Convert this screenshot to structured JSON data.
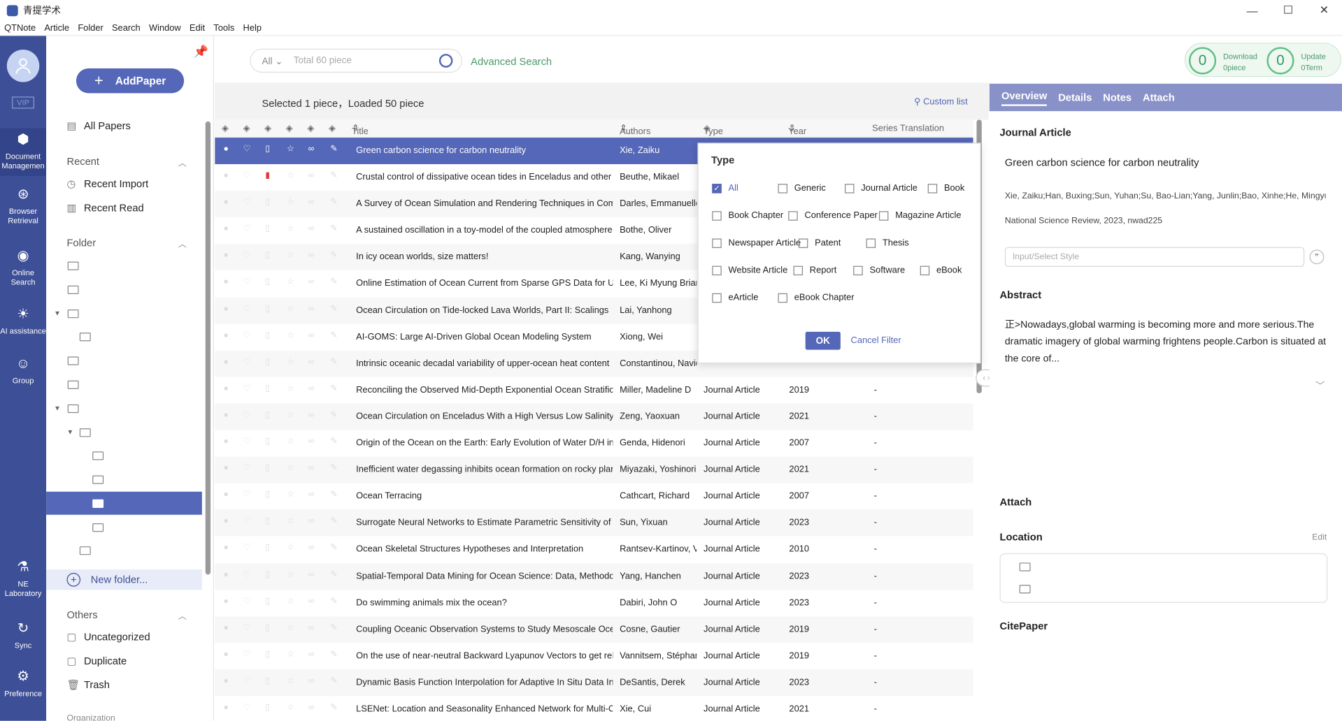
{
  "app": {
    "title": "青提学术"
  },
  "menu": [
    "QTNote",
    "Article",
    "Folder",
    "Search",
    "Window",
    "Edit",
    "Tools",
    "Help"
  ],
  "rail": {
    "vip": "VIP",
    "items": [
      {
        "label": "Document Managemen",
        "icon": "cube-icon"
      },
      {
        "label": "Browser Retrieval",
        "icon": "compass-icon"
      },
      {
        "label": "Online Search",
        "icon": "eye-icon"
      },
      {
        "label": "AI assistance",
        "icon": "bulb-icon"
      },
      {
        "label": "Group",
        "icon": "group-icon"
      },
      {
        "label": "NE Laboratory",
        "icon": "microscope-icon"
      },
      {
        "label": "Sync",
        "icon": "sync-icon"
      },
      {
        "label": "Preference",
        "icon": "gear-icon"
      }
    ]
  },
  "sidebar": {
    "add_paper": "AddPaper",
    "all_papers": "All Papers",
    "recent": "Recent",
    "recent_import": "Recent Import",
    "recent_read": "Recent Read",
    "folder": "Folder",
    "new_folder": "New folder...",
    "others": "Others",
    "uncategorized": "Uncategorized",
    "duplicate": "Duplicate",
    "trash": "Trash",
    "organization": "Organization"
  },
  "search": {
    "scope": "All",
    "placeholder": "Total 60 piece",
    "advanced": "Advanced Search"
  },
  "status": {
    "download_count": "0",
    "download_label": "Download",
    "download_sub": "0piece",
    "update_count": "0",
    "update_label": "Update",
    "update_sub": "0Term"
  },
  "list": {
    "info": "Selected 1 piece，Loaded 50 piece",
    "custom": "Custom list",
    "headers": {
      "title": "Title",
      "authors": "Authors",
      "type": "Type",
      "year": "Year",
      "series": "Series Translation"
    },
    "rows": [
      {
        "title": "Green carbon science for carbon neutrality",
        "author": "Xie, Zaiku",
        "type": "",
        "year": "",
        "series": ""
      },
      {
        "title": "Crustal control of dissipative ocean tides in Enceladus and other icy m",
        "author": "Beuthe, Mikael",
        "type": "",
        "year": "",
        "series": ""
      },
      {
        "title": "A Survey of Ocean Simulation and Rendering Techniques in Compute",
        "author": "Darles, Emmanuelle",
        "type": "",
        "year": "",
        "series": ""
      },
      {
        "title": "A sustained oscillation in a toy-model of the coupled atmosphere-oce",
        "author": "Bothe, Oliver",
        "type": "",
        "year": "",
        "series": ""
      },
      {
        "title": "In icy ocean worlds, size matters!",
        "author": "Kang, Wanying",
        "type": "",
        "year": "",
        "series": ""
      },
      {
        "title": "Online Estimation of Ocean Current from Sparse GPS Data for Underv",
        "author": "Lee, Ki Myung Brian",
        "type": "",
        "year": "",
        "series": ""
      },
      {
        "title": "Ocean Circulation on Tide-locked Lava Worlds, Part II: Scalings",
        "author": "Lai, Yanhong",
        "type": "",
        "year": "",
        "series": ""
      },
      {
        "title": "AI-GOMS: Large AI-Driven Global Ocean Modeling System",
        "author": "Xiong, Wei",
        "type": "",
        "year": "",
        "series": ""
      },
      {
        "title": "Intrinsic oceanic decadal variability of upper-ocean heat content",
        "author": "Constantinou, Navid",
        "type": "",
        "year": "",
        "series": ""
      },
      {
        "title": "Reconciling the Observed Mid-Depth Exponential Ocean Stratification",
        "author": "Miller, Madeline D",
        "type": "Journal Article",
        "year": "2019",
        "series": "-"
      },
      {
        "title": "Ocean Circulation on Enceladus With a High Versus Low Salinity Ocea",
        "author": "Zeng, Yaoxuan",
        "type": "Journal Article",
        "year": "2021",
        "series": "-"
      },
      {
        "title": "Origin of the Ocean on the Earth: Early Evolution of Water D/H in a Hy",
        "author": "Genda, Hidenori",
        "type": "Journal Article",
        "year": "2007",
        "series": "-"
      },
      {
        "title": "Inefficient water degassing inhibits ocean formation on rocky planets:",
        "author": "Miyazaki, Yoshinori",
        "type": "Journal Article",
        "year": "2021",
        "series": "-"
      },
      {
        "title": "Ocean Terracing",
        "author": "Cathcart, Richard",
        "type": "Journal Article",
        "year": "2007",
        "series": "-"
      },
      {
        "title": "Surrogate Neural Networks to Estimate Parametric Sensitivity of Ocea",
        "author": "Sun, Yixuan",
        "type": "Journal Article",
        "year": "2023",
        "series": "-"
      },
      {
        "title": "Ocean Skeletal Structures Hypotheses and Interpretation",
        "author": "Rantsev-Kartinov, V A",
        "type": "Journal Article",
        "year": "2010",
        "series": "-"
      },
      {
        "title": "Spatial-Temporal Data Mining for Ocean Science: Data, Methodologie",
        "author": "Yang, Hanchen",
        "type": "Journal Article",
        "year": "2023",
        "series": "-"
      },
      {
        "title": "Do swimming animals mix the ocean?",
        "author": "Dabiri, John O",
        "type": "Journal Article",
        "year": "2023",
        "series": "-"
      },
      {
        "title": "Coupling Oceanic Observation Systems to Study Mesoscale Ocean Dy",
        "author": "Cosne, Gautier",
        "type": "Journal Article",
        "year": "2019",
        "series": "-"
      },
      {
        "title": "On the use of near-neutral Backward Lyapunov Vectors to get reliable",
        "author": "Vannitsem, Stéphane",
        "type": "Journal Article",
        "year": "2019",
        "series": "-"
      },
      {
        "title": "Dynamic Basis Function Interpolation for Adaptive In Situ Data Integr",
        "author": "DeSantis, Derek",
        "type": "Journal Article",
        "year": "2023",
        "series": "-"
      },
      {
        "title": "LSENet: Location and Seasonality Enhanced Network for Multi-Class C",
        "author": "Xie, Cui",
        "type": "Journal Article",
        "year": "2021",
        "series": "-"
      }
    ]
  },
  "filter": {
    "title": "Type",
    "options": [
      {
        "label": "All",
        "checked": true
      },
      {
        "label": "Generic",
        "checked": false
      },
      {
        "label": "Journal Article",
        "checked": false
      },
      {
        "label": "Book",
        "checked": false
      },
      {
        "label": "Book Chapter",
        "checked": false
      },
      {
        "label": "Conference Paper",
        "checked": false
      },
      {
        "label": "Magazine Article",
        "checked": false
      },
      {
        "label": "Newspaper Article",
        "checked": false
      },
      {
        "label": "Patent",
        "checked": false
      },
      {
        "label": "Thesis",
        "checked": false
      },
      {
        "label": "Website Article",
        "checked": false
      },
      {
        "label": "Report",
        "checked": false
      },
      {
        "label": "Software",
        "checked": false
      },
      {
        "label": "eBook",
        "checked": false
      },
      {
        "label": "eArticle",
        "checked": false
      },
      {
        "label": "eBook Chapter",
        "checked": false
      }
    ],
    "ok": "OK",
    "cancel": "Cancel Filter"
  },
  "detail": {
    "tabs": [
      "Overview",
      "Details",
      "Notes",
      "Attach"
    ],
    "type": "Journal Article",
    "title": "Green carbon science for carbon neutrality",
    "authors": "Xie, Zaiku;Han, Buxing;Sun, Yuhan;Su, Bao-Lian;Yang, Junlin;Bao, Xinhe;He, Mingyuan;",
    "journal": "National Science Review, 2023, nwad225",
    "style_placeholder": "Input/Select Style",
    "abstract_h": "Abstract",
    "abstract": "正>Nowadays,global warming is becoming more and more serious.The dramatic imagery of global warming frightens people.Carbon is situated at the core of...",
    "attach_h": "Attach",
    "location_h": "Location",
    "edit": "Edit",
    "citepaper_h": "CitePaper"
  }
}
